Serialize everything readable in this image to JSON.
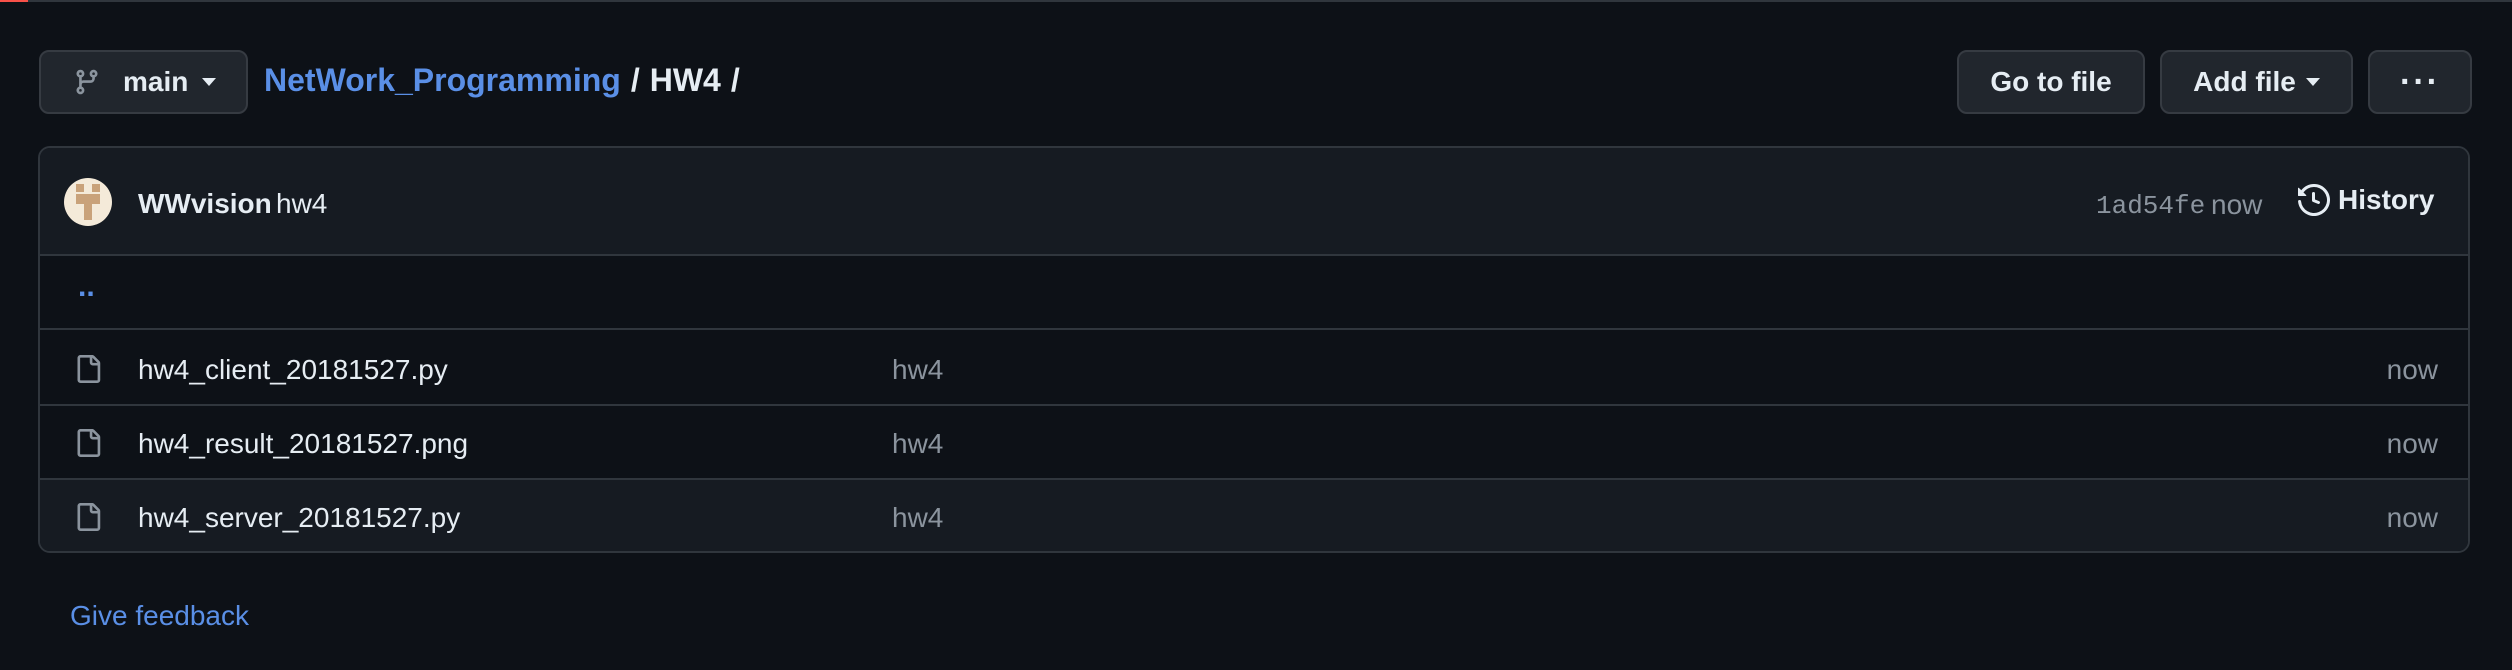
{
  "branch": {
    "name": "main",
    "icon": "git-branch-icon"
  },
  "breadcrumb": {
    "repo": "NetWork_Programming",
    "sep1": "/",
    "folder": "HW4",
    "sep2": "/"
  },
  "actions": {
    "go_to_file": "Go to file",
    "add_file": "Add file",
    "more": "···"
  },
  "commit": {
    "author": "WWvision",
    "message": "hw4",
    "sha": "1ad54fe",
    "time": "now",
    "history_label": "History",
    "history_icon": "history-icon"
  },
  "parent_dir": "..",
  "files": [
    {
      "name": "hw4_client_20181527.py",
      "message": "hw4",
      "time": "now",
      "icon": "file-icon"
    },
    {
      "name": "hw4_result_20181527.png",
      "message": "hw4",
      "time": "now",
      "icon": "file-icon"
    },
    {
      "name": "hw4_server_20181527.py",
      "message": "hw4",
      "time": "now",
      "icon": "file-icon"
    }
  ],
  "feedback": "Give feedback",
  "colors": {
    "background": "#0d1117",
    "link": "#5a8fe6",
    "muted": "#8b949e",
    "accent_line": "#f85149"
  }
}
